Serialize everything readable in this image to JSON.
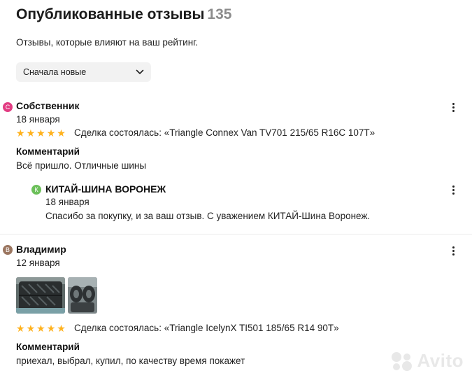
{
  "header": {
    "title": "Опубликованные отзывы",
    "count": "135",
    "subtitle": "Отзывы, которые влияют на ваш рейтинг."
  },
  "sort": {
    "selected": "Сначала новые"
  },
  "reviews": [
    {
      "avatar_letter": "С",
      "avatar_color": "#e23c82",
      "author": "Собственник",
      "date": "18 января",
      "rating": 5,
      "deal": "Сделка состоялась: «Triangle Connex Van TV701 215/65 R16C 107T»",
      "comment_label": "Комментарий",
      "comment": "Всё пришло. Отличные шины",
      "reply": {
        "avatar_letter": "К",
        "avatar_color": "#6cc05a",
        "author": "КИТАЙ-ШИНА ВОРОНЕЖ",
        "date": "18 января",
        "text": "Спасибо за покупку, и за ваш отзыв. С уважением КИТАЙ-Шина Воронеж."
      }
    },
    {
      "avatar_letter": "В",
      "avatar_color": "#9b7660",
      "author": "Владимир",
      "date": "12 января",
      "rating": 5,
      "deal": "Сделка состоялась: «Triangle IcelynX TI501 185/65 R14 90T»",
      "comment_label": "Комментарий",
      "comment": "приехал, выбрал, купил, по качеству время покажет"
    }
  ],
  "watermark": {
    "text": "Avito"
  },
  "colors": {
    "star": "#ffb21e",
    "muted": "#8c8c8c",
    "select_bg": "#f2f2f2"
  },
  "icons": {
    "sort": "chevron-down-icon",
    "menu": "kebab-menu-icon",
    "star": "star-icon"
  }
}
